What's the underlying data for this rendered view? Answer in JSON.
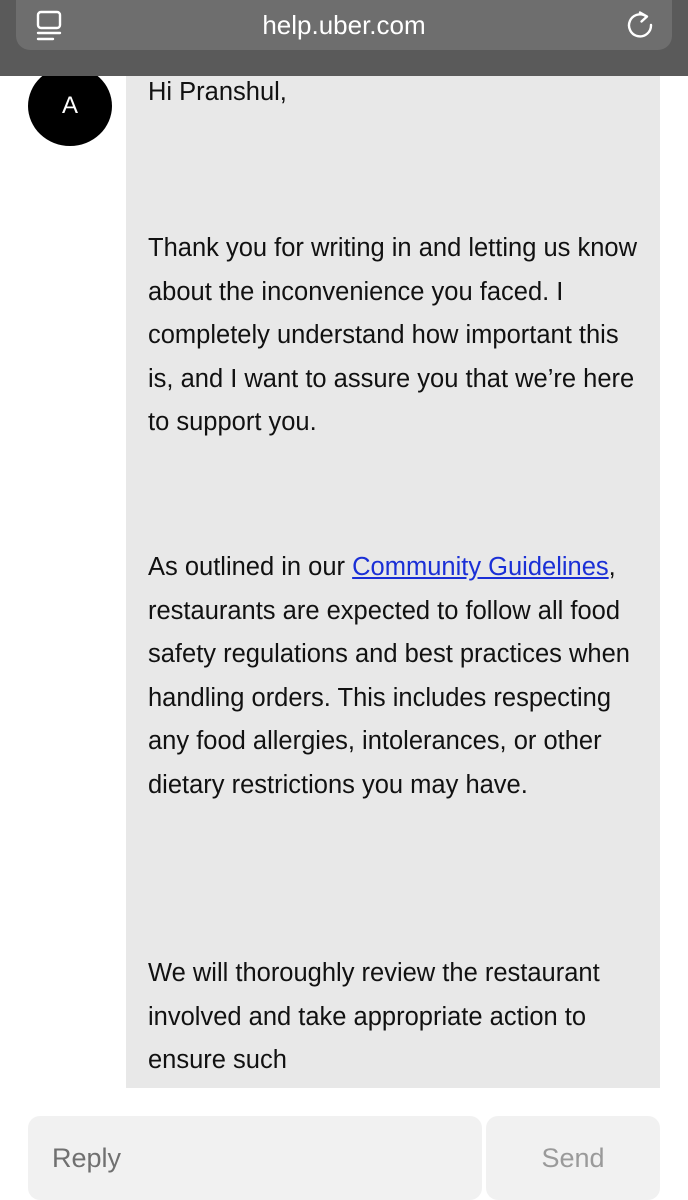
{
  "browser": {
    "url": "help.uber.com",
    "reader_icon": "reader-mode-icon",
    "reload_icon": "reload-icon"
  },
  "avatar": {
    "initial": "A"
  },
  "message": {
    "greeting": "Hi Pranshul,",
    "paragraph1": "Thank you for writing in and letting us know about the inconvenience you faced. I completely understand how important this is, and I want to assure you that we’re here to support you.",
    "paragraph2_before_link": "As outlined in our ",
    "paragraph2_link": "Community Guidelines",
    "paragraph2_after_link": ", restaurants are expected to follow all food safety regulations and best practices when handling orders. This includes respecting any food allergies, intolerances, or other dietary restrictions you may have.",
    "paragraph3": "We will thoroughly review the restaurant involved and take appropriate action to ensure such"
  },
  "reply": {
    "placeholder": "Reply",
    "value": "",
    "send_label": "Send"
  }
}
